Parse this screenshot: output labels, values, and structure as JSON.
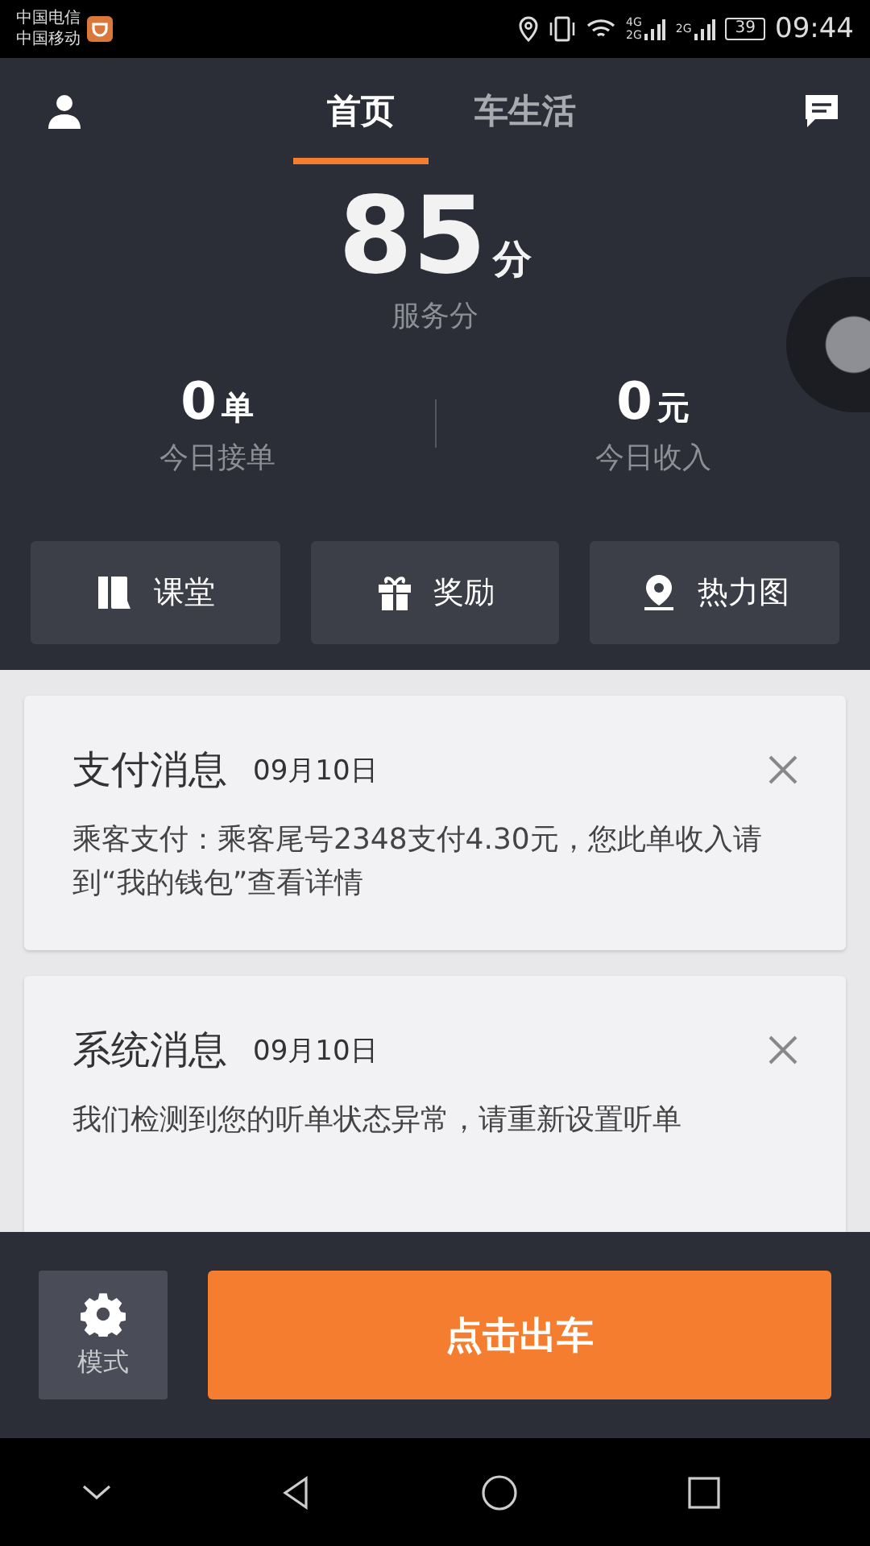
{
  "status_bar": {
    "carriers": [
      "中国电信",
      "中国移动"
    ],
    "sim1_network": [
      "4G",
      "2G"
    ],
    "sim2_network": "2G",
    "battery": "39",
    "time": "09:44"
  },
  "tabs": [
    {
      "label": "首页",
      "selected": true
    },
    {
      "label": "车生活",
      "selected": false
    }
  ],
  "score": {
    "value": "85",
    "unit": "分",
    "label": "服务分"
  },
  "stats": [
    {
      "value": "0",
      "unit": "单",
      "label": "今日接单"
    },
    {
      "value": "0",
      "unit": "元",
      "label": "今日收入"
    }
  ],
  "shortcuts": [
    {
      "kind": "book",
      "label": "课堂"
    },
    {
      "kind": "gift",
      "label": "奖励"
    },
    {
      "kind": "pin",
      "label": "热力图"
    }
  ],
  "messages": [
    {
      "title": "支付消息",
      "date": "09月10日",
      "body": "乘客支付：乘客尾号2348支付4.30元，您此单收入请到“我的钱包”查看详情"
    },
    {
      "title": "系统消息",
      "date": "09月10日",
      "body": "我们检测到您的听单状态异常，请重新设置听单"
    }
  ],
  "mode_button": "模式",
  "start_button": "点击出车"
}
